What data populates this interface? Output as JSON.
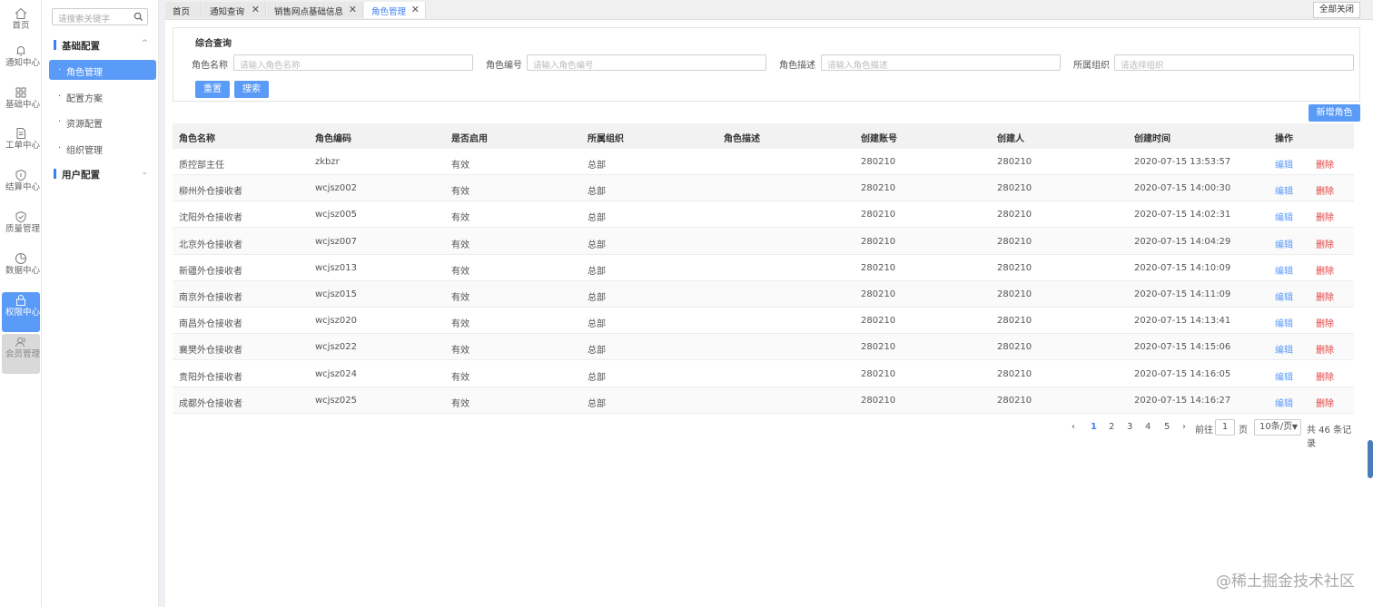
{
  "rail": [
    {
      "label": "首页",
      "icon": "home-icon"
    },
    {
      "label": "通知中心",
      "icon": "bell-icon"
    },
    {
      "label": "基础中心",
      "icon": "grid-icon"
    },
    {
      "label": "工单中心",
      "icon": "document-icon"
    },
    {
      "label": "结算中心",
      "icon": "shield-icon"
    },
    {
      "label": "质量管理",
      "icon": "shield-check-icon"
    },
    {
      "label": "数据中心",
      "icon": "pie-chart-icon"
    },
    {
      "label": "权限中心",
      "icon": "lock-icon"
    },
    {
      "label": "会员管理",
      "icon": "users-icon"
    }
  ],
  "submenu": {
    "search_placeholder": "请搜索关键字",
    "group1": "基础配置",
    "items": [
      "角色管理",
      "配置方案",
      "资源配置",
      "组织管理"
    ],
    "group2": "用户配置"
  },
  "tabs": [
    {
      "label": "首页"
    },
    {
      "label": "通知查询"
    },
    {
      "label": "销售网点基础信息"
    },
    {
      "label": "角色管理"
    }
  ],
  "close_all": "全部关闭",
  "query": {
    "title": "综合查询",
    "fields": [
      {
        "label": "角色名称",
        "placeholder": "请输入角色名称"
      },
      {
        "label": "角色编号",
        "placeholder": "请输入角色编号"
      },
      {
        "label": "角色描述",
        "placeholder": "请输入角色描述"
      },
      {
        "label": "所属组织",
        "placeholder": "请选择组织"
      }
    ],
    "reset": "重置",
    "search": "搜索"
  },
  "add_role": "新增角色",
  "table": {
    "headers": [
      "角色名称",
      "角色编码",
      "是否启用",
      "所属组织",
      "角色描述",
      "创建账号",
      "创建人",
      "创建时间",
      "操作"
    ],
    "edit": "编辑",
    "delete": "删除",
    "rows": [
      [
        "质控部主任",
        "zkbzr",
        "有效",
        "总部",
        "",
        "280210",
        "280210",
        "2020-07-15 13:53:57"
      ],
      [
        "柳州外仓接收者",
        "wcjsz002",
        "有效",
        "总部",
        "",
        "280210",
        "280210",
        "2020-07-15 14:00:30"
      ],
      [
        "沈阳外仓接收者",
        "wcjsz005",
        "有效",
        "总部",
        "",
        "280210",
        "280210",
        "2020-07-15 14:02:31"
      ],
      [
        "北京外仓接收者",
        "wcjsz007",
        "有效",
        "总部",
        "",
        "280210",
        "280210",
        "2020-07-15 14:04:29"
      ],
      [
        "新疆外仓接收者",
        "wcjsz013",
        "有效",
        "总部",
        "",
        "280210",
        "280210",
        "2020-07-15 14:10:09"
      ],
      [
        "南京外仓接收者",
        "wcjsz015",
        "有效",
        "总部",
        "",
        "280210",
        "280210",
        "2020-07-15 14:11:09"
      ],
      [
        "南昌外仓接收者",
        "wcjsz020",
        "有效",
        "总部",
        "",
        "280210",
        "280210",
        "2020-07-15 14:13:41"
      ],
      [
        "襄樊外仓接收者",
        "wcjsz022",
        "有效",
        "总部",
        "",
        "280210",
        "280210",
        "2020-07-15 14:15:06"
      ],
      [
        "贵阳外仓接收者",
        "wcjsz024",
        "有效",
        "总部",
        "",
        "280210",
        "280210",
        "2020-07-15 14:16:05"
      ],
      [
        "成都外仓接收者",
        "wcjsz025",
        "有效",
        "总部",
        "",
        "280210",
        "280210",
        "2020-07-15 14:16:27"
      ]
    ]
  },
  "pager": {
    "prev": "‹",
    "next": "›",
    "pages": [
      "1",
      "2",
      "3",
      "4",
      "5"
    ],
    "goto_label": "前往",
    "goto_value": "1",
    "page_unit": "页",
    "page_size": "10条/页",
    "total": "共 46 条记录"
  },
  "watermark": "@稀土掘金技术社区",
  "colors": {
    "accent": "#5b9bf8",
    "danger": "#e53e3e"
  }
}
